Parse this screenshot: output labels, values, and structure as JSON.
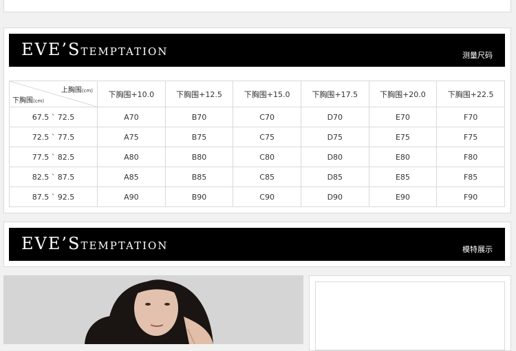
{
  "brand": {
    "logo_big_1": "EVE",
    "logo_apostrophe": "’",
    "logo_big_2": "S",
    "logo_small": "TEMPTATION"
  },
  "sections": {
    "size_chart_label": "测量尺码",
    "model_label": "模特展示"
  },
  "size_table": {
    "corner_top": "上胸围",
    "corner_bottom": "下胸围",
    "unit": "(cm)",
    "columns": [
      "下胸围+10.0",
      "下胸围+12.5",
      "下胸围+15.0",
      "下胸围+17.5",
      "下胸围+20.0",
      "下胸围+22.5"
    ],
    "rows": [
      {
        "range": "67.5 ` 72.5",
        "sizes": [
          "A70",
          "B70",
          "C70",
          "D70",
          "E70",
          "F70"
        ]
      },
      {
        "range": "72.5 ` 77.5",
        "sizes": [
          "A75",
          "B75",
          "C75",
          "D75",
          "E75",
          "F75"
        ]
      },
      {
        "range": "77.5 ` 82.5",
        "sizes": [
          "A80",
          "B80",
          "C80",
          "D80",
          "E80",
          "F80"
        ]
      },
      {
        "range": "82.5 ` 87.5",
        "sizes": [
          "A85",
          "B85",
          "C85",
          "D85",
          "E85",
          "F85"
        ]
      },
      {
        "range": "87.5 ` 92.5",
        "sizes": [
          "A90",
          "B90",
          "C90",
          "D90",
          "E90",
          "F90"
        ]
      }
    ]
  },
  "colors": {
    "banner": "#000000",
    "page_bg": "#f1f1f1",
    "border": "#d9d9d9"
  }
}
